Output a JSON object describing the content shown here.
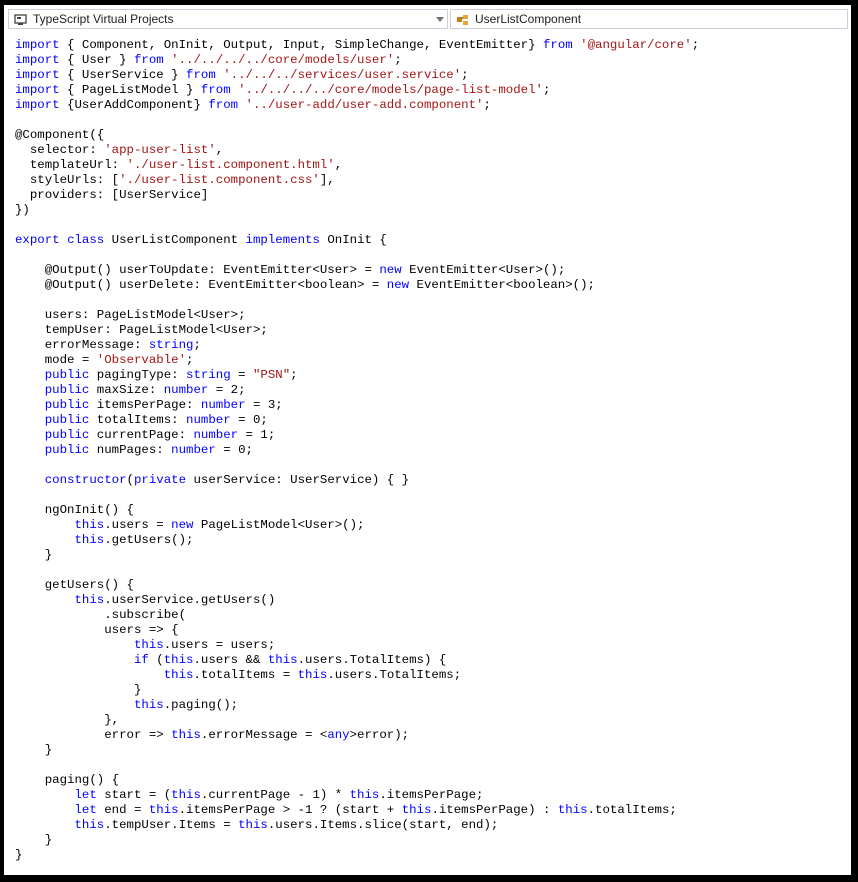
{
  "navbar": {
    "project_dropdown": {
      "label": "TypeScript Virtual Projects",
      "icon": "project-icon"
    },
    "member_dropdown": {
      "label": "UserListComponent",
      "icon": "class-icon"
    }
  },
  "colors": {
    "keyword": "#0000ff",
    "string": "#a31515",
    "text": "#000000"
  },
  "code_lines": [
    [
      [
        "k",
        "import"
      ],
      [
        "t",
        " { Component, OnInit, Output, Input, SimpleChange, EventEmitter} "
      ],
      [
        "k",
        "from"
      ],
      [
        "t",
        " "
      ],
      [
        "s",
        "'@angular/core'"
      ],
      [
        "t",
        ";"
      ]
    ],
    [
      [
        "k",
        "import"
      ],
      [
        "t",
        " { User } "
      ],
      [
        "k",
        "from"
      ],
      [
        "t",
        " "
      ],
      [
        "s",
        "'../../../../core/models/user'"
      ],
      [
        "t",
        ";"
      ]
    ],
    [
      [
        "k",
        "import"
      ],
      [
        "t",
        " { UserService } "
      ],
      [
        "k",
        "from"
      ],
      [
        "t",
        " "
      ],
      [
        "s",
        "'../../../services/user.service'"
      ],
      [
        "t",
        ";"
      ]
    ],
    [
      [
        "k",
        "import"
      ],
      [
        "t",
        " { PageListModel } "
      ],
      [
        "k",
        "from"
      ],
      [
        "t",
        " "
      ],
      [
        "s",
        "'../../../../core/models/page-list-model'"
      ],
      [
        "t",
        ";"
      ]
    ],
    [
      [
        "k",
        "import"
      ],
      [
        "t",
        " {UserAddComponent} "
      ],
      [
        "k",
        "from"
      ],
      [
        "t",
        " "
      ],
      [
        "s",
        "'../user-add/user-add.component'"
      ],
      [
        "t",
        ";"
      ]
    ],
    [],
    [
      [
        "t",
        "@Component({"
      ]
    ],
    [
      [
        "t",
        "  selector: "
      ],
      [
        "s",
        "'app-user-list'"
      ],
      [
        "t",
        ","
      ]
    ],
    [
      [
        "t",
        "  templateUrl: "
      ],
      [
        "s",
        "'./user-list.component.html'"
      ],
      [
        "t",
        ","
      ]
    ],
    [
      [
        "t",
        "  styleUrls: ["
      ],
      [
        "s",
        "'./user-list.component.css'"
      ],
      [
        "t",
        "],"
      ]
    ],
    [
      [
        "t",
        "  providers: [UserService]"
      ]
    ],
    [
      [
        "t",
        "})"
      ]
    ],
    [],
    [
      [
        "k",
        "export"
      ],
      [
        "t",
        " "
      ],
      [
        "k",
        "class"
      ],
      [
        "t",
        " UserListComponent "
      ],
      [
        "k",
        "implements"
      ],
      [
        "t",
        " OnInit {"
      ]
    ],
    [],
    [
      [
        "t",
        "    @Output() userToUpdate: EventEmitter<User> = "
      ],
      [
        "k",
        "new"
      ],
      [
        "t",
        " EventEmitter<User>();"
      ]
    ],
    [
      [
        "t",
        "    @Output() userDelete: EventEmitter<boolean> = "
      ],
      [
        "k",
        "new"
      ],
      [
        "t",
        " EventEmitter<boolean>();"
      ]
    ],
    [],
    [
      [
        "t",
        "    users: PageListModel<User>;"
      ]
    ],
    [
      [
        "t",
        "    tempUser: PageListModel<User>;"
      ]
    ],
    [
      [
        "t",
        "    errorMessage: "
      ],
      [
        "k",
        "string"
      ],
      [
        "t",
        ";"
      ]
    ],
    [
      [
        "t",
        "    mode = "
      ],
      [
        "s",
        "'Observable'"
      ],
      [
        "t",
        ";"
      ]
    ],
    [
      [
        "k",
        "    public"
      ],
      [
        "t",
        " pagingType: "
      ],
      [
        "k",
        "string"
      ],
      [
        "t",
        " = "
      ],
      [
        "s",
        "\"PSN\""
      ],
      [
        "t",
        ";"
      ]
    ],
    [
      [
        "k",
        "    public"
      ],
      [
        "t",
        " maxSize: "
      ],
      [
        "k",
        "number"
      ],
      [
        "t",
        " = 2;"
      ]
    ],
    [
      [
        "k",
        "    public"
      ],
      [
        "t",
        " itemsPerPage: "
      ],
      [
        "k",
        "number"
      ],
      [
        "t",
        " = 3;"
      ]
    ],
    [
      [
        "k",
        "    public"
      ],
      [
        "t",
        " totalItems: "
      ],
      [
        "k",
        "number"
      ],
      [
        "t",
        " = 0;"
      ]
    ],
    [
      [
        "k",
        "    public"
      ],
      [
        "t",
        " currentPage: "
      ],
      [
        "k",
        "number"
      ],
      [
        "t",
        " = 1;"
      ]
    ],
    [
      [
        "k",
        "    public"
      ],
      [
        "t",
        " numPages: "
      ],
      [
        "k",
        "number"
      ],
      [
        "t",
        " = 0;"
      ]
    ],
    [],
    [
      [
        "k",
        "    constructor"
      ],
      [
        "t",
        "("
      ],
      [
        "k",
        "private"
      ],
      [
        "t",
        " userService: UserService) { }"
      ]
    ],
    [],
    [
      [
        "t",
        "    ngOnInit() {"
      ]
    ],
    [
      [
        "k",
        "        this"
      ],
      [
        "t",
        ".users = "
      ],
      [
        "k",
        "new"
      ],
      [
        "t",
        " PageListModel<User>();"
      ]
    ],
    [
      [
        "k",
        "        this"
      ],
      [
        "t",
        ".getUsers();"
      ]
    ],
    [
      [
        "t",
        "    }"
      ]
    ],
    [],
    [
      [
        "t",
        "    getUsers() {"
      ]
    ],
    [
      [
        "k",
        "        this"
      ],
      [
        "t",
        ".userService.getUsers()"
      ]
    ],
    [
      [
        "t",
        "            .subscribe("
      ]
    ],
    [
      [
        "t",
        "            users => {"
      ]
    ],
    [
      [
        "k",
        "                this"
      ],
      [
        "t",
        ".users = users;"
      ]
    ],
    [
      [
        "k",
        "                if"
      ],
      [
        "t",
        " ("
      ],
      [
        "k",
        "this"
      ],
      [
        "t",
        ".users && "
      ],
      [
        "k",
        "this"
      ],
      [
        "t",
        ".users.TotalItems) {"
      ]
    ],
    [
      [
        "k",
        "                    this"
      ],
      [
        "t",
        ".totalItems = "
      ],
      [
        "k",
        "this"
      ],
      [
        "t",
        ".users.TotalItems;"
      ]
    ],
    [
      [
        "t",
        "                }"
      ]
    ],
    [
      [
        "k",
        "                this"
      ],
      [
        "t",
        ".paging();"
      ]
    ],
    [
      [
        "t",
        "            },"
      ]
    ],
    [
      [
        "t",
        "            error => "
      ],
      [
        "k",
        "this"
      ],
      [
        "t",
        ".errorMessage = <"
      ],
      [
        "k",
        "any"
      ],
      [
        "t",
        ">error);"
      ]
    ],
    [
      [
        "t",
        "    }"
      ]
    ],
    [],
    [
      [
        "t",
        "    paging() {"
      ]
    ],
    [
      [
        "k",
        "        let"
      ],
      [
        "t",
        " start = ("
      ],
      [
        "k",
        "this"
      ],
      [
        "t",
        ".currentPage - 1) * "
      ],
      [
        "k",
        "this"
      ],
      [
        "t",
        ".itemsPerPage;"
      ]
    ],
    [
      [
        "k",
        "        let"
      ],
      [
        "t",
        " end = "
      ],
      [
        "k",
        "this"
      ],
      [
        "t",
        ".itemsPerPage > -1 ? (start + "
      ],
      [
        "k",
        "this"
      ],
      [
        "t",
        ".itemsPerPage) : "
      ],
      [
        "k",
        "this"
      ],
      [
        "t",
        ".totalItems;"
      ]
    ],
    [
      [
        "k",
        "        this"
      ],
      [
        "t",
        ".tempUser.Items = "
      ],
      [
        "k",
        "this"
      ],
      [
        "t",
        ".users.Items.slice(start, end);"
      ]
    ],
    [
      [
        "t",
        "    }"
      ]
    ],
    [
      [
        "t",
        "}"
      ]
    ]
  ]
}
